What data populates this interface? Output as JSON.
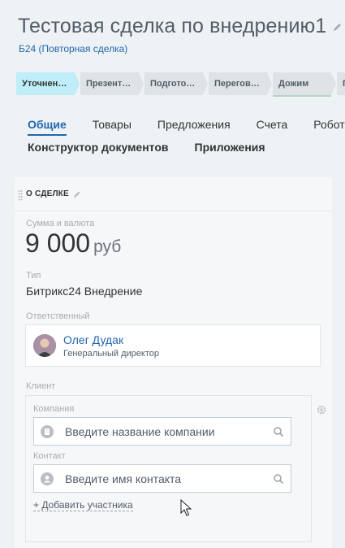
{
  "header": {
    "title": "Тестовая сделка по внедрению1",
    "subtitle": "Б24 (Повторная сделка)"
  },
  "stages": [
    {
      "label": "Уточнен…",
      "active": true
    },
    {
      "label": "Презент…",
      "active": false
    },
    {
      "label": "Подгото…",
      "active": false
    },
    {
      "label": "Перегов…",
      "active": false
    },
    {
      "label": "Дожим",
      "active": false
    },
    {
      "label": "П",
      "active": false
    }
  ],
  "tabs": {
    "row1": [
      "Общие",
      "Товары",
      "Предложения",
      "Счета",
      "Роботы"
    ],
    "row2": [
      "Конструктор документов",
      "Приложения"
    ]
  },
  "card": {
    "title": "О СДЕЛКЕ",
    "amount_label": "Сумма и валюта",
    "amount": "9 000",
    "currency": "руб",
    "type_label": "Тип",
    "type_value": "Битрикс24 Внедрение",
    "responsible_label": "Ответственный",
    "responsible_name": "Олег Дудак",
    "responsible_position": "Генеральный директор",
    "client_label": "Клиент",
    "company_label": "Компания",
    "company_placeholder": "Введите название компании",
    "contact_label": "Контакт",
    "contact_placeholder": "Введите имя контакта",
    "add_member": "+ Добавить участника"
  },
  "colors": {
    "accent": "#2067b0",
    "stage_active": "#bfeef8",
    "stage_inactive": "#dfe3e6"
  }
}
